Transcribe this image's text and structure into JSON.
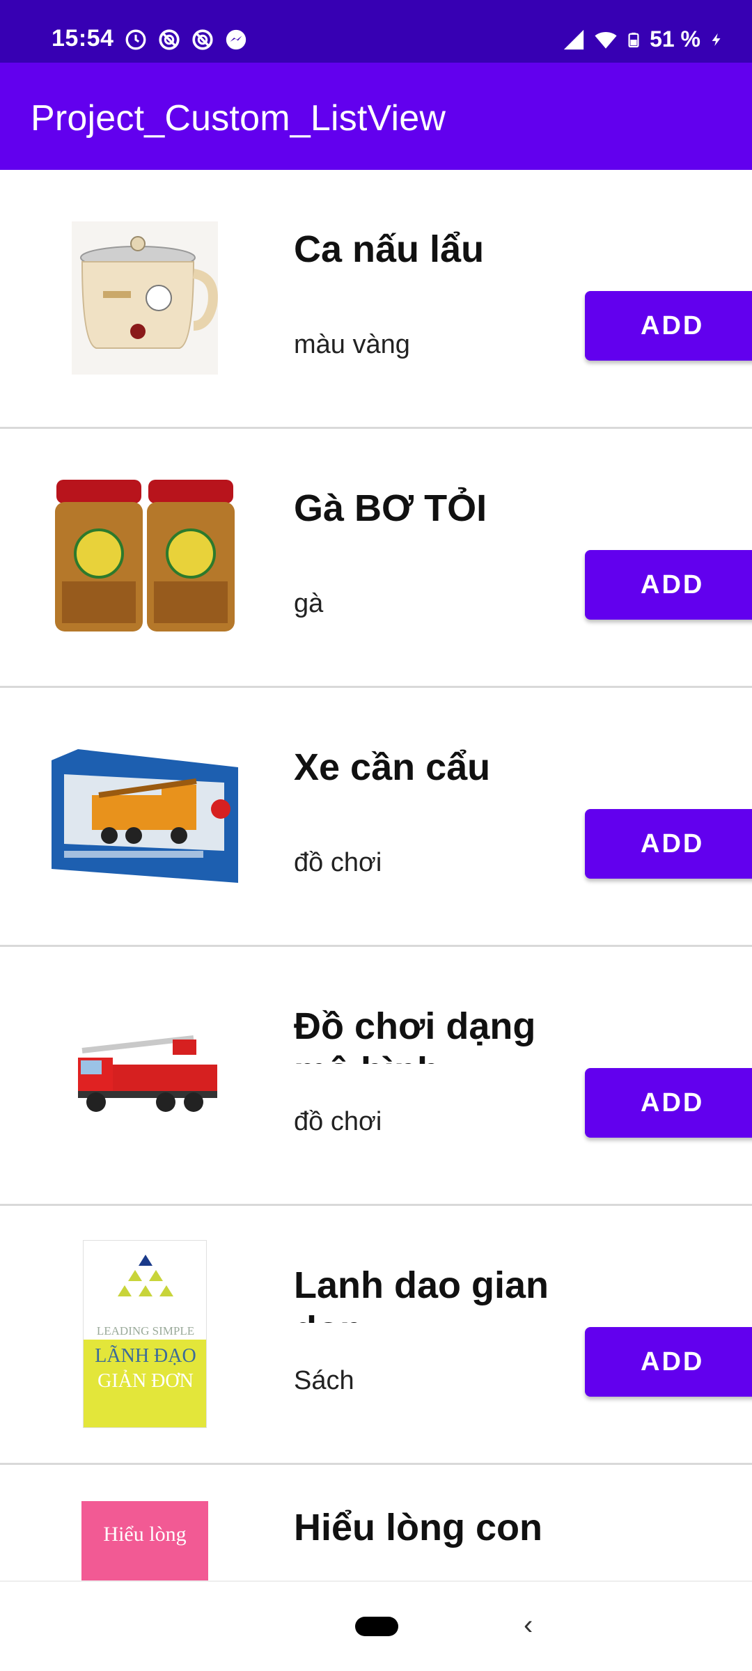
{
  "status_bar": {
    "time": "15:54",
    "battery": "51 %",
    "icons_left": [
      "clock-icon",
      "do-not-disturb-icon",
      "do-not-disturb-icon",
      "messenger-icon"
    ],
    "icons_right": [
      "signal-icon",
      "wifi-icon",
      "battery-icon",
      "charging-icon"
    ]
  },
  "app_bar": {
    "title": "Project_Custom_ListView"
  },
  "colors": {
    "primary": "#6200EE",
    "primary_dark": "#3700B3",
    "divider": "#d9d9d9"
  },
  "products": [
    {
      "name": "Ca nấu lẩu",
      "desc": "màu vàng",
      "button": "ADD",
      "image": "electric-pot-image"
    },
    {
      "name": "Gà BƠ TỎI",
      "desc": "gà",
      "button": "ADD",
      "image": "garlic-chicken-jars-image"
    },
    {
      "name": "Xe cần cẩu",
      "desc": "đồ chơi",
      "button": "ADD",
      "image": "crane-truck-toy-box-image"
    },
    {
      "name": "Đồ chơi dạng mô hình",
      "desc": "đồ chơi",
      "button": "ADD",
      "image": "fire-truck-model-image"
    },
    {
      "name": "Lanh dao gian don",
      "desc": "Sách",
      "button": "ADD",
      "image": "book-cover-image",
      "cover_top": "LEADING SIMPLE",
      "cover_title_1": "LÃNH ĐẠO",
      "cover_title_2": "GIẢN ĐƠN"
    },
    {
      "name": "Hiểu lòng con",
      "desc": "",
      "button": "",
      "image": "book-cover-pink-image",
      "cover_title": "Hiểu lòng"
    }
  ],
  "nav_bar": {
    "home": "home-pill-icon",
    "back": "‹"
  }
}
